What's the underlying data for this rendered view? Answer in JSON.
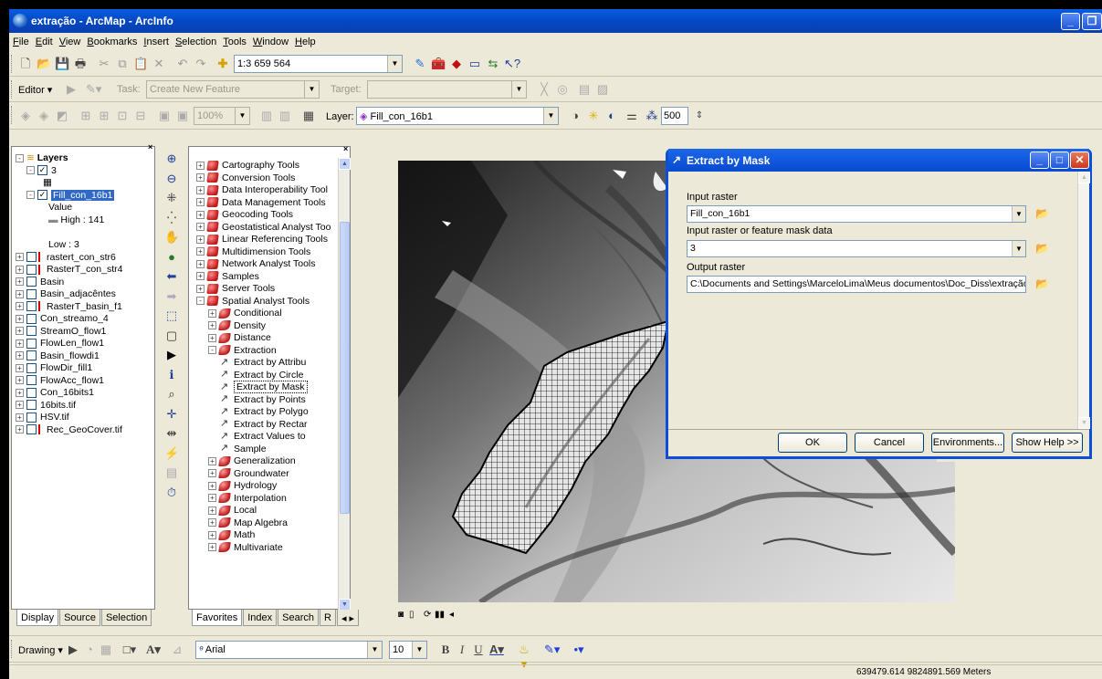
{
  "window": {
    "title": "extração - ArcMap - ArcInfo"
  },
  "menu": [
    {
      "key": "F",
      "rest": "ile"
    },
    {
      "key": "E",
      "rest": "dit"
    },
    {
      "key": "V",
      "rest": "iew"
    },
    {
      "key": "B",
      "rest": "ookmarks"
    },
    {
      "key": "I",
      "rest": "nsert"
    },
    {
      "key": "S",
      "rest": "election"
    },
    {
      "key": "T",
      "rest": "ools"
    },
    {
      "key": "W",
      "rest": "indow"
    },
    {
      "key": "H",
      "rest": "elp"
    }
  ],
  "standard_toolbar": {
    "scale": "1:3 659 564"
  },
  "editor_toolbar": {
    "editor_label": "Editor",
    "task_label": "Task:",
    "task_value": "Create New Feature",
    "target_label": "Target:",
    "target_value": ""
  },
  "spatial_toolbar": {
    "zoom": "100%",
    "layer_label": "Layer:",
    "layer_value": "Fill_con_16b1",
    "contrast": "500"
  },
  "toc": {
    "root": "Layers",
    "items": [
      {
        "label": "3",
        "indent": 1,
        "checked": true,
        "expander": "-"
      },
      {
        "label": "Fill_con_16b1",
        "indent": 1,
        "checked": true,
        "expander": "-",
        "selected": true
      },
      {
        "label": "Value",
        "indent": 3
      },
      {
        "label": "High : 141",
        "indent": 3
      },
      {
        "label": "Low : 3",
        "indent": 3
      },
      {
        "label": "rastert_con_str6",
        "indent": 0,
        "checked": false,
        "expander": "+",
        "red": true
      },
      {
        "label": "RasterT_con_str4",
        "indent": 0,
        "checked": false,
        "expander": "+",
        "red": true
      },
      {
        "label": "Basin",
        "indent": 0,
        "checked": false,
        "expander": "+"
      },
      {
        "label": "Basin_adjacêntes",
        "indent": 0,
        "checked": false,
        "expander": "+"
      },
      {
        "label": "RasterT_basin_f1",
        "indent": 0,
        "checked": false,
        "expander": "+",
        "red": true
      },
      {
        "label": "Con_streamo_4",
        "indent": 0,
        "checked": false,
        "expander": "+"
      },
      {
        "label": "StreamO_flow1",
        "indent": 0,
        "checked": false,
        "expander": "+"
      },
      {
        "label": "FlowLen_flow1",
        "indent": 0,
        "checked": false,
        "expander": "+"
      },
      {
        "label": "Basin_flowdi1",
        "indent": 0,
        "checked": false,
        "expander": "+"
      },
      {
        "label": "FlowDir_fill1",
        "indent": 0,
        "checked": false,
        "expander": "+"
      },
      {
        "label": "FlowAcc_flow1",
        "indent": 0,
        "checked": false,
        "expander": "+"
      },
      {
        "label": "Con_16bits1",
        "indent": 0,
        "checked": false,
        "expander": "+"
      },
      {
        "label": "16bits.tif",
        "indent": 0,
        "checked": false,
        "expander": "+"
      },
      {
        "label": "HSV.tif",
        "indent": 0,
        "checked": false,
        "expander": "+"
      },
      {
        "label": "Rec_GeoCover.tif",
        "indent": 0,
        "checked": false,
        "expander": "+",
        "red": true
      }
    ],
    "tabs": [
      "Display",
      "Source",
      "Selection"
    ]
  },
  "toolbox": {
    "items": [
      {
        "label": "Cartography Tools",
        "indent": 0,
        "type": "box",
        "expander": "+"
      },
      {
        "label": "Conversion Tools",
        "indent": 0,
        "type": "box",
        "expander": "+"
      },
      {
        "label": "Data Interoperability Tool",
        "indent": 0,
        "type": "box",
        "expander": "+"
      },
      {
        "label": "Data Management Tools",
        "indent": 0,
        "type": "box",
        "expander": "+"
      },
      {
        "label": "Geocoding Tools",
        "indent": 0,
        "type": "box",
        "expander": "+"
      },
      {
        "label": "Geostatistical Analyst Too",
        "indent": 0,
        "type": "box",
        "expander": "+"
      },
      {
        "label": "Linear Referencing Tools",
        "indent": 0,
        "type": "box",
        "expander": "+"
      },
      {
        "label": "Multidimension Tools",
        "indent": 0,
        "type": "box",
        "expander": "+"
      },
      {
        "label": "Network Analyst Tools",
        "indent": 0,
        "type": "box",
        "expander": "+"
      },
      {
        "label": "Samples",
        "indent": 0,
        "type": "box",
        "expander": "+"
      },
      {
        "label": "Server Tools",
        "indent": 0,
        "type": "box",
        "expander": "+"
      },
      {
        "label": "Spatial Analyst Tools",
        "indent": 0,
        "type": "box",
        "expander": "-"
      },
      {
        "label": "Conditional",
        "indent": 1,
        "type": "set",
        "expander": "+"
      },
      {
        "label": "Density",
        "indent": 1,
        "type": "set",
        "expander": "+"
      },
      {
        "label": "Distance",
        "indent": 1,
        "type": "set",
        "expander": "+"
      },
      {
        "label": "Extraction",
        "indent": 1,
        "type": "set",
        "expander": "-"
      },
      {
        "label": "Extract by Attribu",
        "indent": 2,
        "type": "tool"
      },
      {
        "label": "Extract by Circle",
        "indent": 2,
        "type": "tool"
      },
      {
        "label": "Extract by Mask",
        "indent": 2,
        "type": "tool",
        "selected": true
      },
      {
        "label": "Extract by Points",
        "indent": 2,
        "type": "tool"
      },
      {
        "label": "Extract by Polygo",
        "indent": 2,
        "type": "tool"
      },
      {
        "label": "Extract by Rectar",
        "indent": 2,
        "type": "tool"
      },
      {
        "label": "Extract Values to",
        "indent": 2,
        "type": "tool"
      },
      {
        "label": "Sample",
        "indent": 2,
        "type": "tool"
      },
      {
        "label": "Generalization",
        "indent": 1,
        "type": "set",
        "expander": "+"
      },
      {
        "label": "Groundwater",
        "indent": 1,
        "type": "set",
        "expander": "+"
      },
      {
        "label": "Hydrology",
        "indent": 1,
        "type": "set",
        "expander": "+"
      },
      {
        "label": "Interpolation",
        "indent": 1,
        "type": "set",
        "expander": "+"
      },
      {
        "label": "Local",
        "indent": 1,
        "type": "set",
        "expander": "+"
      },
      {
        "label": "Map Algebra",
        "indent": 1,
        "type": "set",
        "expander": "+"
      },
      {
        "label": "Math",
        "indent": 1,
        "type": "set",
        "expander": "+"
      },
      {
        "label": "Multivariate",
        "indent": 1,
        "type": "set",
        "expander": "+"
      }
    ],
    "tabs": [
      "Favorites",
      "Index",
      "Search",
      "R"
    ]
  },
  "dialog": {
    "title": "Extract by Mask",
    "input_raster_label": "Input raster",
    "input_raster_value": "Fill_con_16b1",
    "mask_label": "Input raster or feature mask data",
    "mask_value": "3",
    "output_label": "Output raster",
    "output_value": "C:\\Documents and Settings\\MarceloLima\\Meus documentos\\Doc_Diss\\extração\\E",
    "ok": "OK",
    "cancel": "Cancel",
    "environments": "Environments...",
    "show_help": "Show Help >>"
  },
  "drawing_toolbar": {
    "drawing_label": "Drawing",
    "font": "Arial",
    "font_size": "10"
  },
  "status": {
    "coords": "639479.614  9824891.569 Meters"
  }
}
